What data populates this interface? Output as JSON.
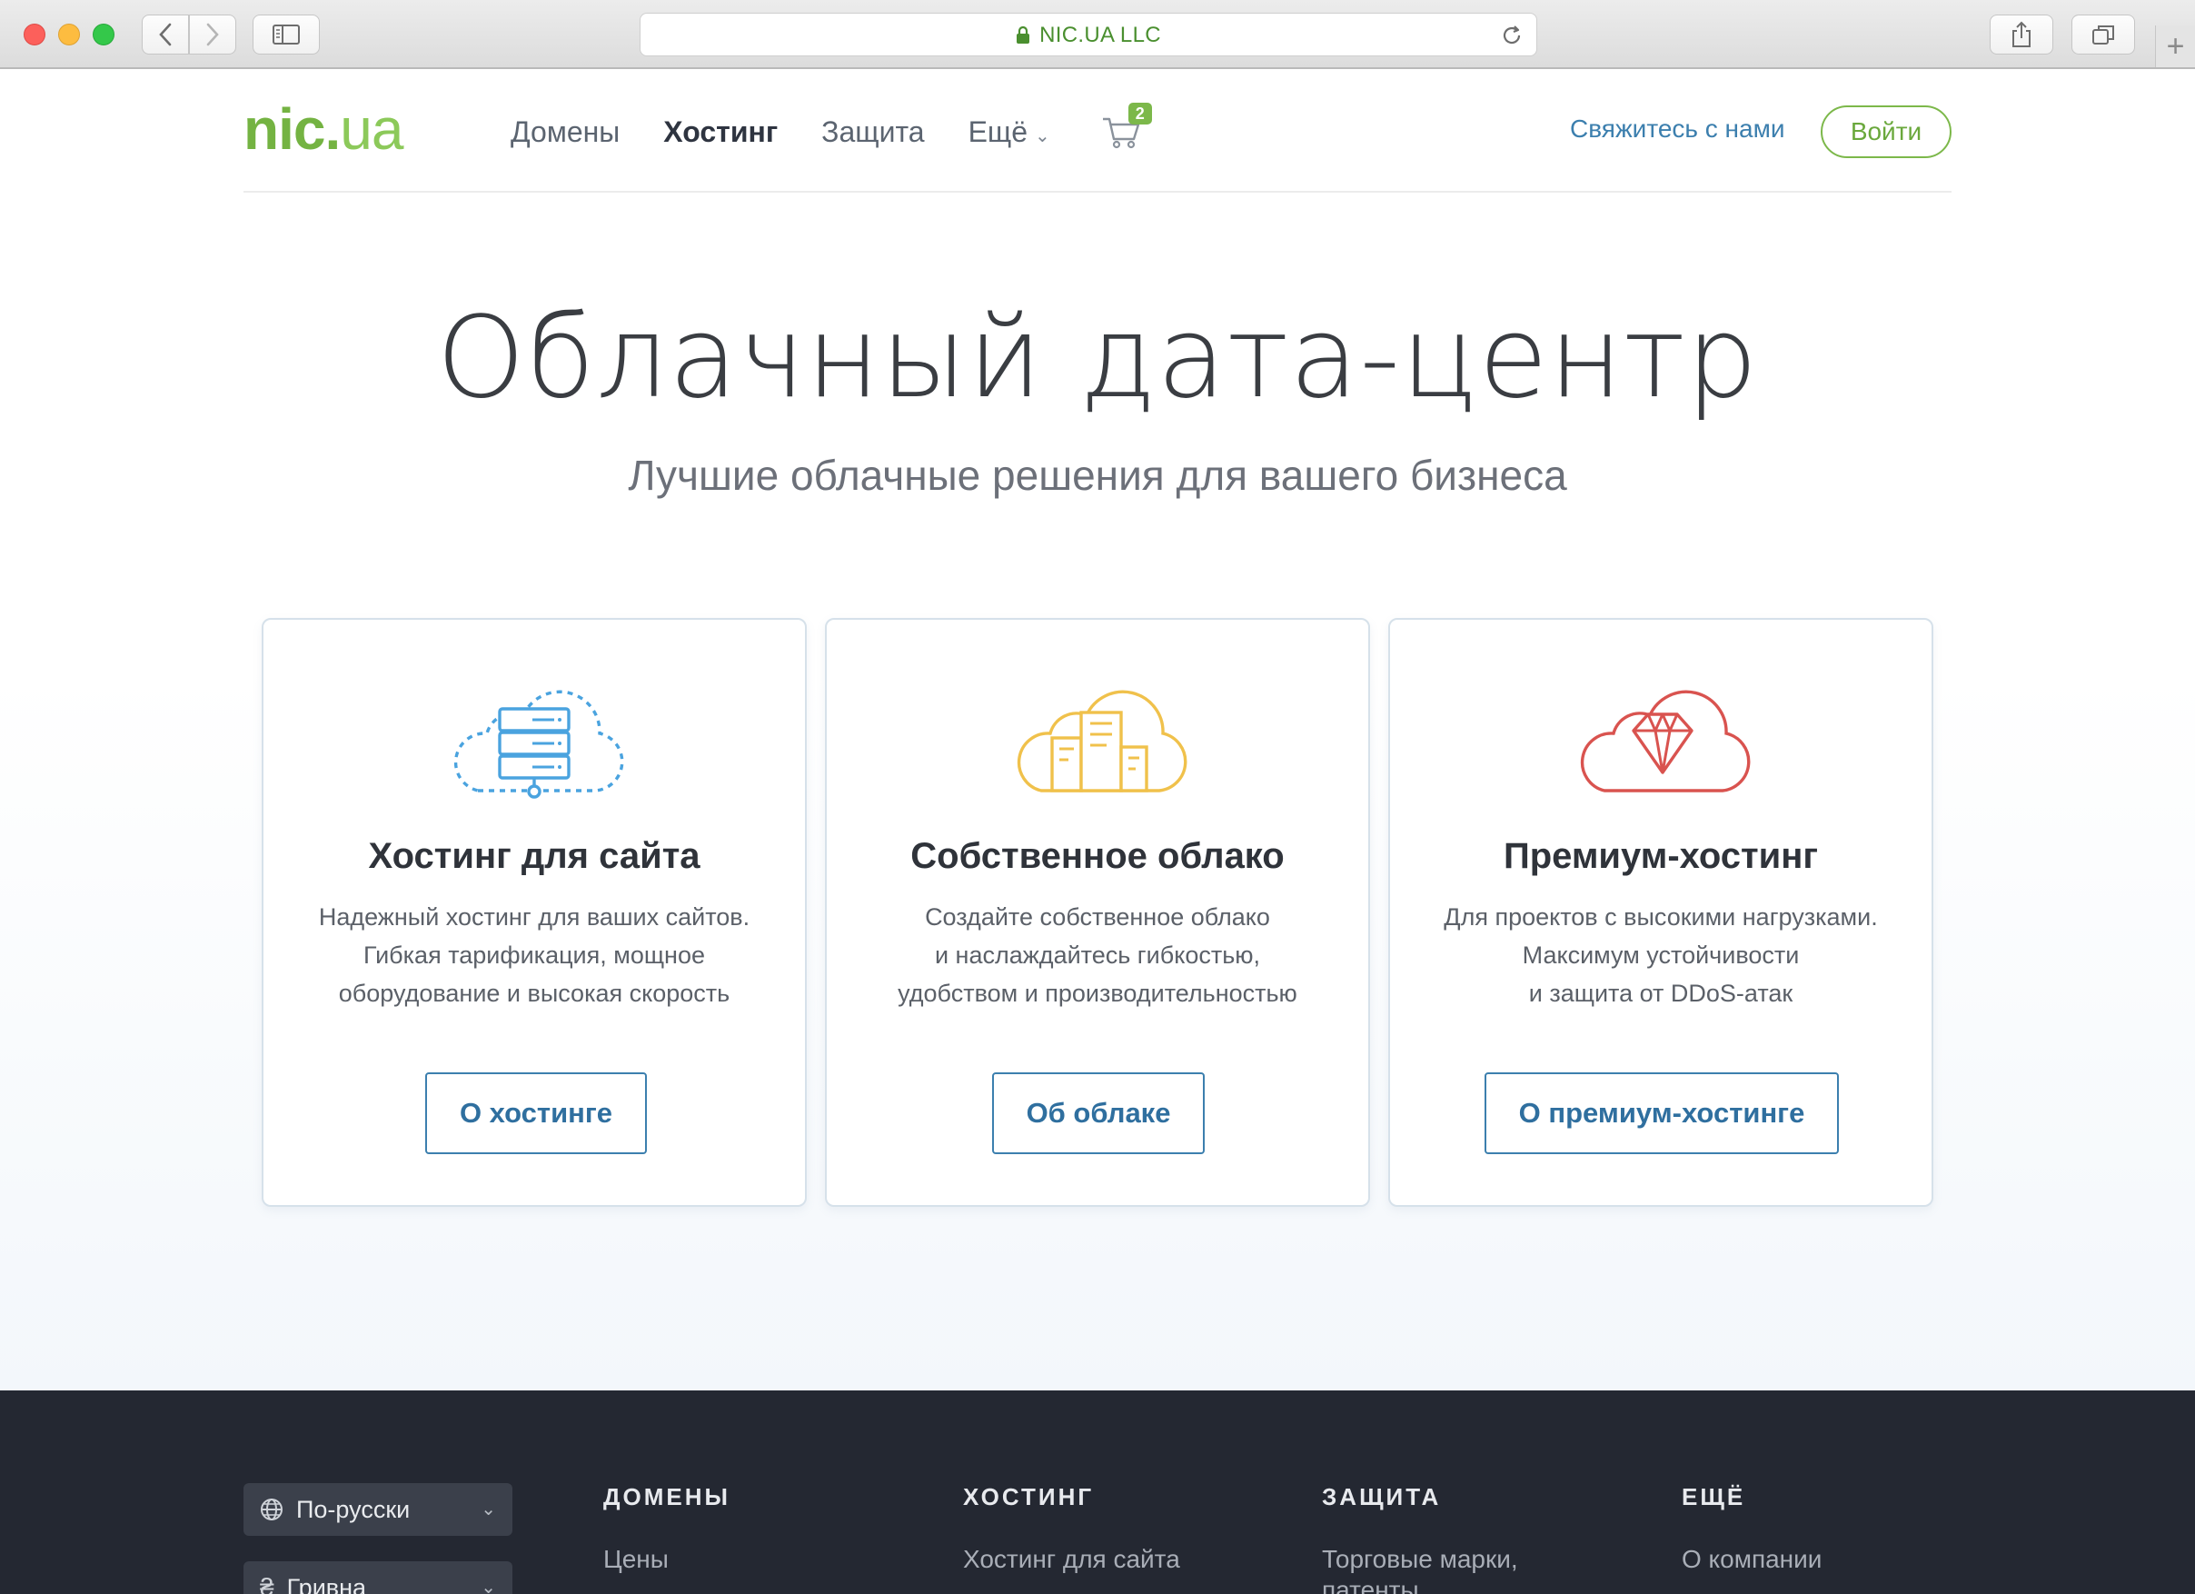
{
  "browser": {
    "address": "NIC.UA LLC",
    "accent": "#4a8f2f"
  },
  "header": {
    "logo_main": "nic",
    "logo_dot": ".",
    "logo_tld": "ua",
    "nav": [
      {
        "label": "Домены"
      },
      {
        "label": "Хостинг"
      },
      {
        "label": "Защита"
      },
      {
        "label": "Ещё"
      }
    ],
    "cart_count": "2",
    "contact_label": "Свяжитесь с нами",
    "login_label": "Войти",
    "brand_color": "#74b342"
  },
  "hero": {
    "title": "Облачный дата-центр",
    "subtitle": "Лучшие облачные решения для вашего бизнеса"
  },
  "cards": [
    {
      "icon": "cloud-server-icon",
      "title": "Хостинг для сайта",
      "desc": [
        "Надежный хостинг для ваших сайтов.",
        "Гибкая тарификация, мощное",
        "оборудование и высокая скорость"
      ],
      "button": "О хостинге",
      "color": "#4aa3df"
    },
    {
      "icon": "cloud-buildings-icon",
      "title": "Собственное облако",
      "desc": [
        "Создайте собственное облако",
        "и наслаждайтесь гибкостью,",
        "удобством и производительностью"
      ],
      "button": "Об облаке",
      "color": "#f0c14b"
    },
    {
      "icon": "cloud-diamond-icon",
      "title": "Премиум-хостинг",
      "desc": [
        "Для проектов с высокими нагрузками.",
        "Максимум устойчивости",
        "и защита от DDoS-атак"
      ],
      "button": "О премиум-хостинге",
      "color": "#d9534f"
    }
  ],
  "footer": {
    "language": "По-русски",
    "currency": "Гривна",
    "columns": [
      {
        "heading": "ДОМЕНЫ",
        "link": "Цены"
      },
      {
        "heading": "ХОСТИНГ",
        "link": "Хостинг для сайта"
      },
      {
        "heading": "ЗАЩИТА",
        "link": "Торговые марки, патенты"
      },
      {
        "heading": "ЕЩЁ",
        "link": "О компании"
      }
    ]
  }
}
